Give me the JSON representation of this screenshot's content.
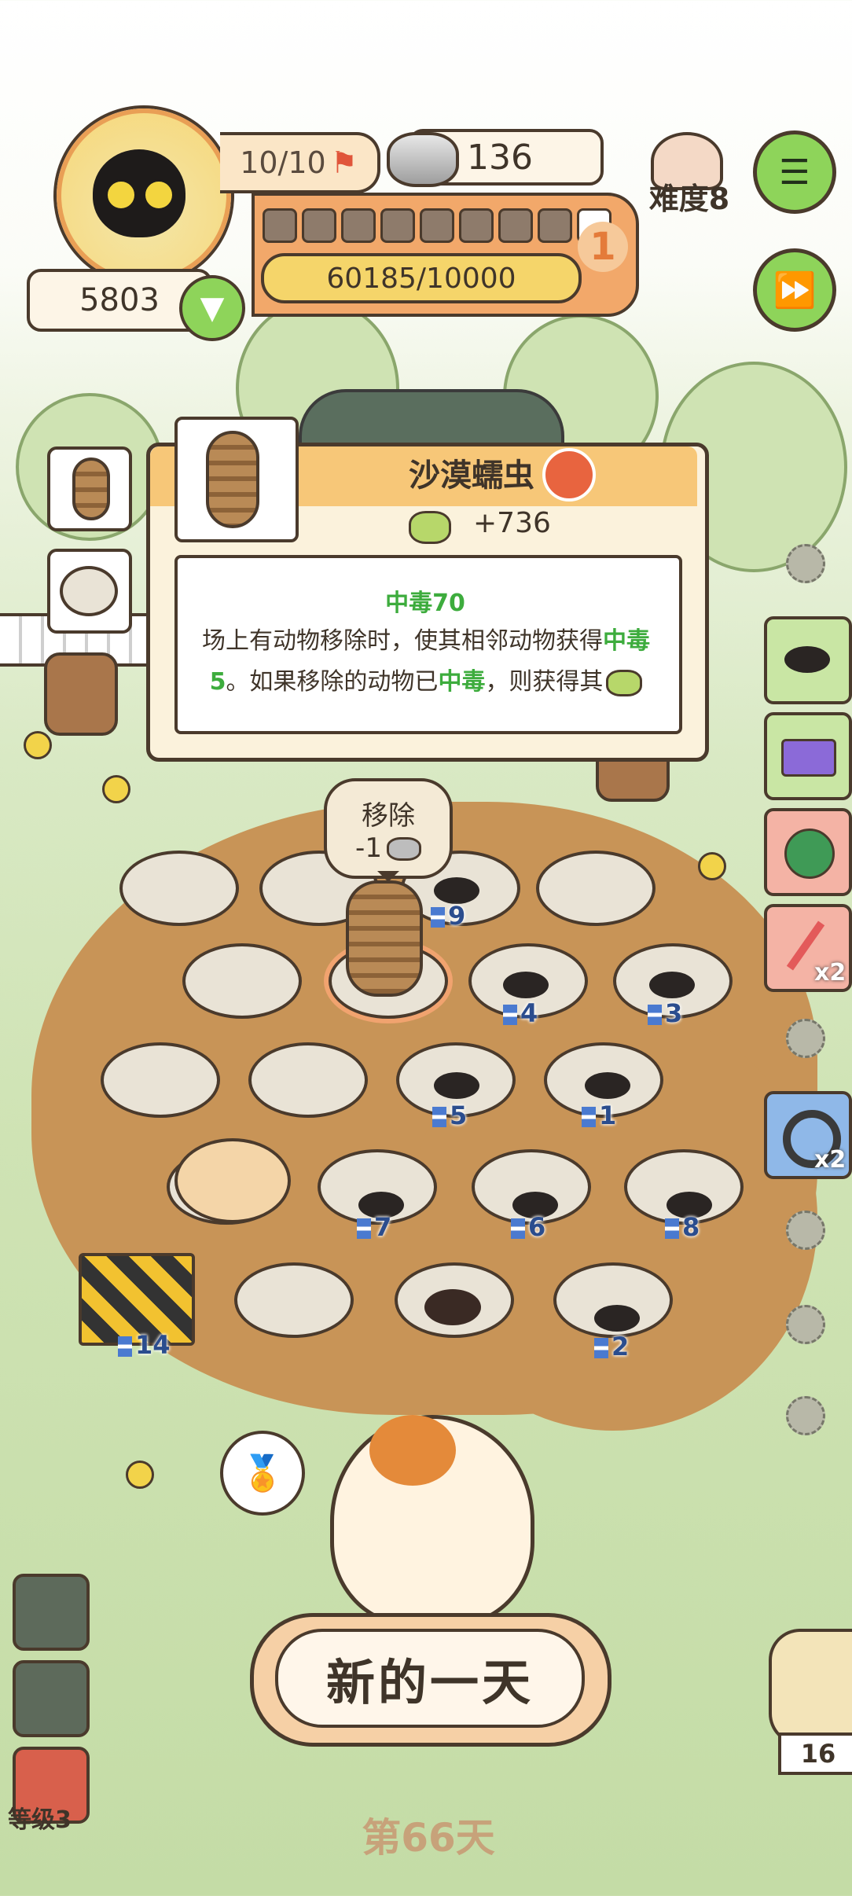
{
  "hud": {
    "lives": "10/10",
    "cans": "136",
    "xp": "60185/10000",
    "level_badge": "1",
    "gold": "5803",
    "difficulty": "难度8",
    "progress_segments_filled": 8,
    "progress_segments_total": 9
  },
  "tooltip": {
    "title": "沙漠蠕虫",
    "reward": "+736",
    "effect_title": "中毒70",
    "desc_part1": "场上有动物移除时，使其相邻动物获得",
    "desc_hl1": "中毒5",
    "desc_part2": "。如果移除的动物已",
    "desc_hl2": "中毒",
    "desc_part3": "，则获得其"
  },
  "bubble": {
    "line1": "移除",
    "line2": "-1"
  },
  "plots": [
    {
      "timer": "9"
    },
    {
      "timer": "4"
    },
    {
      "timer": "3"
    },
    {
      "timer": "5"
    },
    {
      "timer": "1"
    },
    {
      "timer": "7"
    },
    {
      "timer": "6"
    },
    {
      "timer": "8"
    },
    {
      "timer": "14"
    },
    {
      "timer": "2"
    }
  ],
  "side_items": {
    "coupon_mult": "x2",
    "belt_mult": "x2"
  },
  "bottom": {
    "new_day": "新的一天",
    "day": "第66天",
    "level": "等级3",
    "owl_count": "16"
  },
  "colors": {
    "accent_green": "#8ed45a",
    "poison_green": "#3dac3d",
    "dirt": "#c89457",
    "panel_orange": "#f2a86a"
  }
}
